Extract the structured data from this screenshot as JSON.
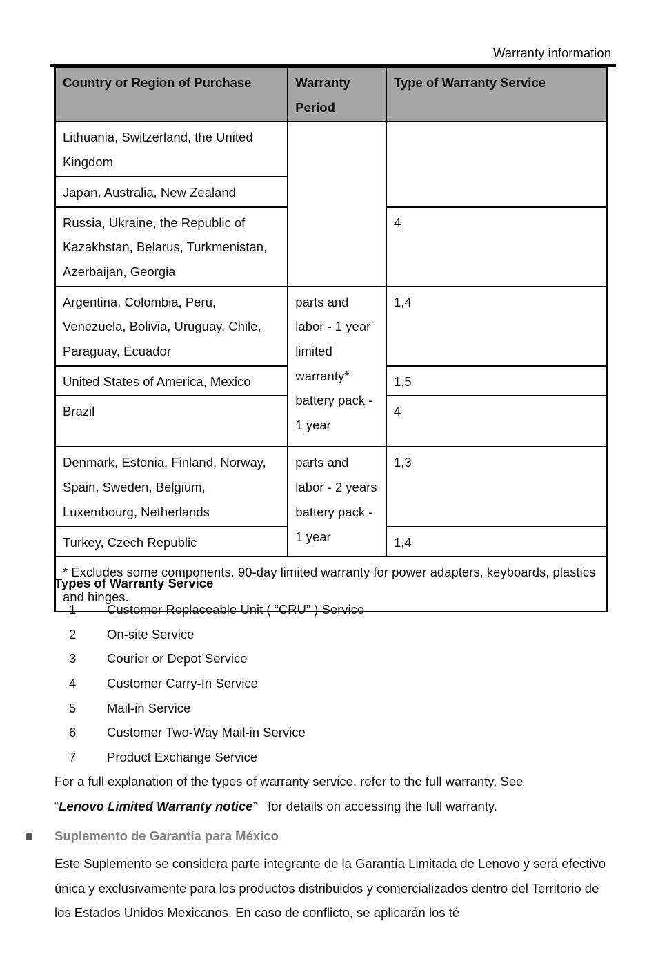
{
  "header": {
    "running_title": "Warranty information"
  },
  "table": {
    "headers": [
      "Country or Region of Purchase",
      "Warranty Period",
      "Type of Warranty Service"
    ],
    "rows": [
      {
        "country": "Lithuania, Switzerland, the United Kingdom"
      },
      {
        "country": "Japan, Australia, New Zealand"
      },
      {
        "country": "Russia, Ukraine, the Republic of Kazakhstan, Belarus, Turkmenistan, Azerbaijan, Georgia",
        "service": "4"
      },
      {
        "country": "Argentina, Colombia, Peru, Venezuela, Bolivia, Uruguay, Chile, Paraguay, Ecuador",
        "service": "1,4"
      },
      {
        "country": "United States of America, Mexico",
        "service": "1,5"
      },
      {
        "country": "Brazil",
        "service": "4"
      },
      {
        "country": "Denmark, Estonia, Finland, Norway, Spain, Sweden, Belgium, Luxembourg, Netherlands",
        "service": "1,3"
      },
      {
        "country": "Turkey, Czech Republic",
        "service": "1,4"
      }
    ],
    "period_group_a": "parts and labor - 1 year limited warranty* battery pack - 1 year",
    "period_group_b": "parts and labor - 2 years battery pack - 1 year",
    "footnote": "* Excludes some components. 90-day limited warranty for power adapters, keyboards, plastics and hinges."
  },
  "types": {
    "title": "Types of Warranty Service",
    "items": [
      {
        "num": "1",
        "label": "Customer Replaceable Unit ( “CRU” ) Service"
      },
      {
        "num": "2",
        "label": "On-site Service"
      },
      {
        "num": "3",
        "label": "Courier or Depot Service"
      },
      {
        "num": "4",
        "label": "Customer Carry-In Service"
      },
      {
        "num": "5",
        "label": "Mail-in Service"
      },
      {
        "num": "6",
        "label": "Customer Two-Way Mail-in Service"
      },
      {
        "num": "7",
        "label": "Product Exchange Service"
      }
    ]
  },
  "explanation": {
    "text_before": "For a full explanation of the types of warranty service, refer to the full warranty. See",
    "open_quote": " “",
    "notice_title": "Lenovo Limited Warranty notice",
    "close_quote": "”",
    "text_after": "   for details on accessing the full warranty."
  },
  "supplement": {
    "heading": "Suplemento de Garantía para México",
    "body": "Este Suplemento se considera parte integrante de la Garantía Limitada de Lenovo y será efectivo única y exclusivamente para los productos distribuidos y comercializados dentro del Territorio de los Estados Unidos Mexicanos. En caso de conflicto, se aplicarán los té"
  }
}
